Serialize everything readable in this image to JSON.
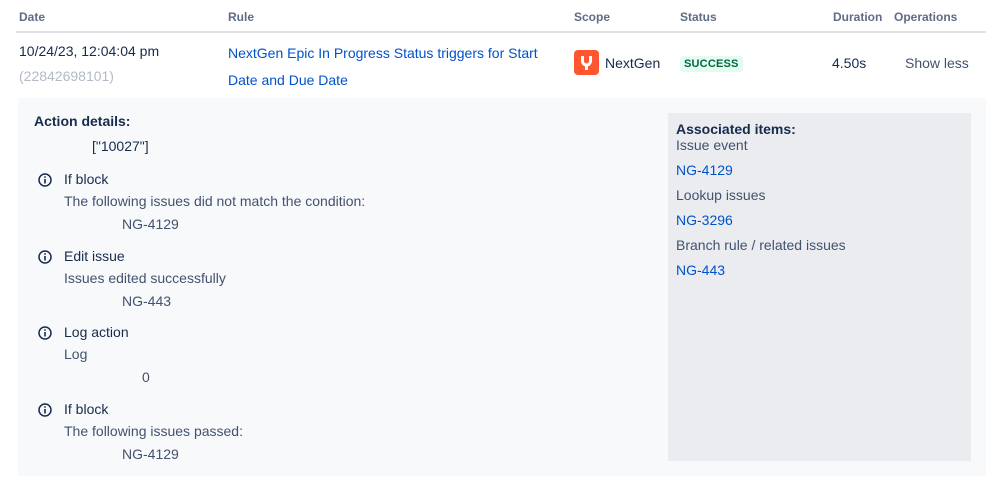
{
  "table": {
    "headers": {
      "date": "Date",
      "rule": "Rule",
      "scope": "Scope",
      "status": "Status",
      "duration": "Duration",
      "operations": "Operations"
    },
    "row": {
      "date": "10/24/23, 12:04:04 pm",
      "execution_id": "(22842698101)",
      "rule": "NextGen Epic In Progress Status triggers for Start Date and Due Date",
      "scope_icon": "project-icon",
      "scope": "NextGen",
      "status": "SUCCESS",
      "duration": "4.50s",
      "operation": "Show less"
    }
  },
  "details": {
    "action_title": "Action details:",
    "action_value": "[\"10027\"]",
    "items": [
      {
        "icon": "info-icon",
        "title": "If block",
        "description": "The following issues did not match the condition:",
        "value": "NG-4129"
      },
      {
        "icon": "info-icon",
        "title": "Edit issue",
        "description": "Issues edited successfully",
        "value": "NG-443"
      },
      {
        "icon": "info-icon",
        "title": "Log action",
        "description": "Log",
        "value": "0"
      },
      {
        "icon": "info-icon",
        "title": "If block",
        "description": "The following issues passed:",
        "value": "NG-4129"
      }
    ]
  },
  "associated": {
    "title": "Associated items:",
    "groups": [
      {
        "label": "Issue event",
        "link": "NG-4129"
      },
      {
        "label": "Lookup issues",
        "link": "NG-3296"
      },
      {
        "label": "Branch rule / related issues",
        "link": "NG-443"
      }
    ]
  },
  "colors": {
    "link": "#0052cc",
    "success_bg": "#e3fcef",
    "success_text": "#006644",
    "scope_icon_bg": "#ff5630"
  }
}
